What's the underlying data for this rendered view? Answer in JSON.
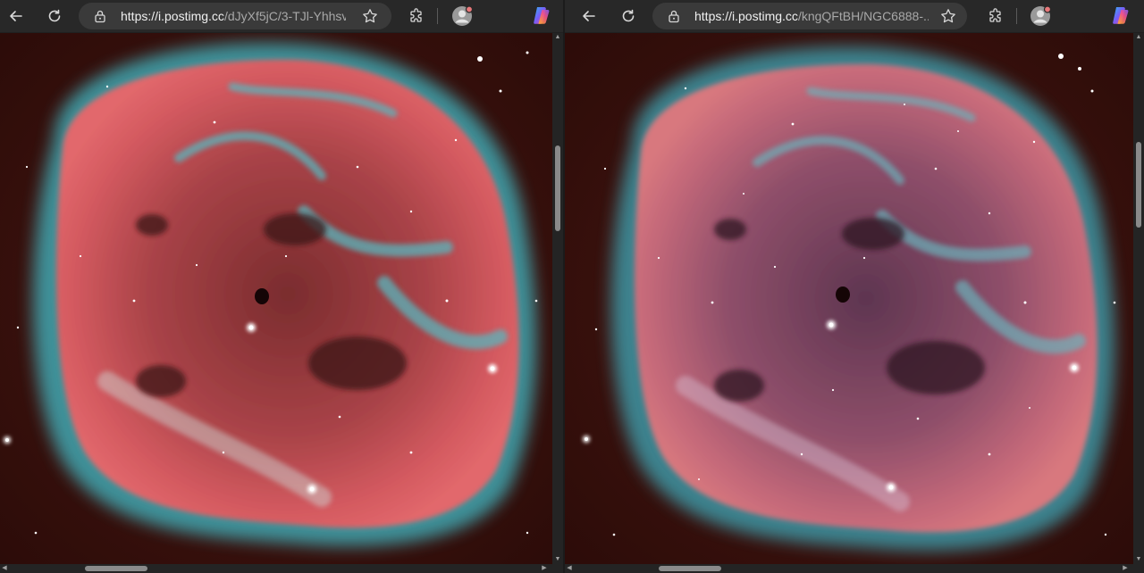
{
  "windows": [
    {
      "id": "left",
      "url_domain": "https://i.postimg.cc",
      "url_path": "/dJyXf5jC/3-TJl-Yhhsv...",
      "nebula_style": "narrowband"
    },
    {
      "id": "right",
      "url_domain": "https://i.postimg.cc",
      "url_path": "/kngQFtBH/NGC6888-...",
      "nebula_style": "natural"
    }
  ],
  "icons": {
    "back": "back-arrow-icon",
    "refresh": "refresh-icon",
    "lock": "lock-icon",
    "favorite": "star-outline-icon",
    "extensions": "puzzle-icon",
    "profile": "profile-avatar-icon",
    "copilot": "copilot-icon"
  },
  "colors": {
    "toolbar": "#282828",
    "address_bar": "#3a3a3a",
    "sky": "#3a100c",
    "nebula_red": "#e0656a",
    "nebula_cyan": "#3f9fa8",
    "profile_badge": "#e8787a"
  }
}
